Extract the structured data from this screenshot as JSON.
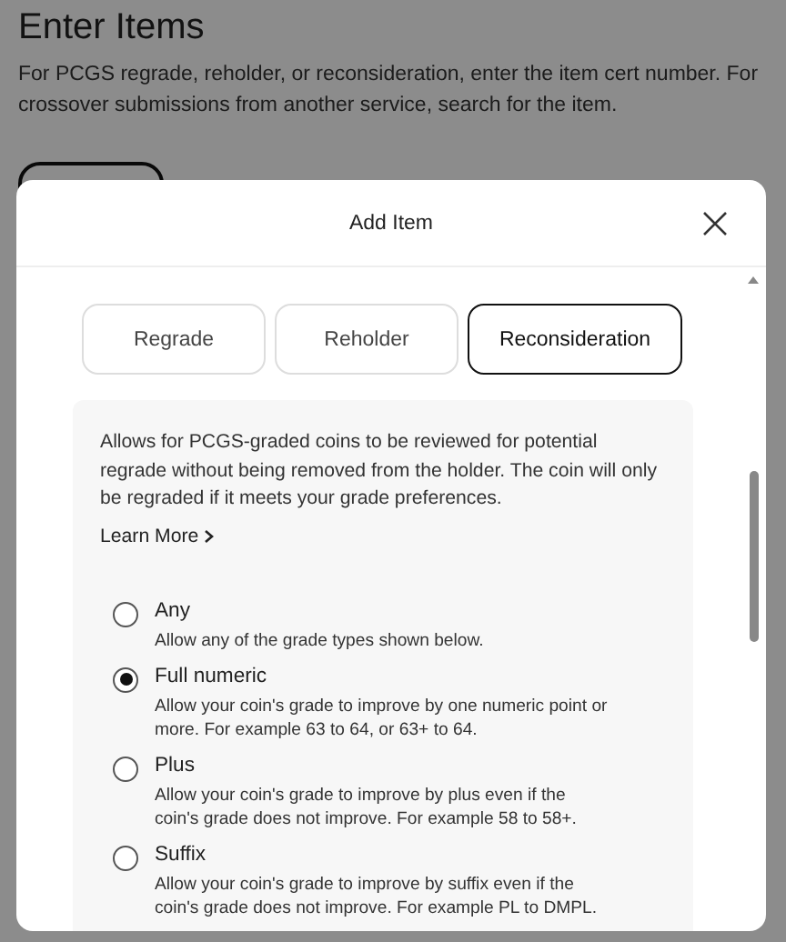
{
  "page": {
    "title": "Enter Items",
    "description": "For PCGS regrade, reholder, or reconsideration, enter the item cert number. For crossover submissions from another service, search for the item."
  },
  "modal": {
    "title": "Add Item",
    "tabs": [
      {
        "label": "Regrade",
        "selected": false
      },
      {
        "label": "Reholder",
        "selected": false
      },
      {
        "label": "Reconsideration",
        "selected": true
      }
    ],
    "info": "Allows for PCGS-graded coins to be reviewed for potential regrade without being removed from the holder. The coin will only be regraded if it meets your grade preferences.",
    "learn_more": "Learn More",
    "options": [
      {
        "label": "Any",
        "description": "Allow any of the grade types shown below.",
        "selected": false
      },
      {
        "label": "Full numeric",
        "description": "Allow your coin's grade to improve by one numeric point or more. For example 63 to 64, or 63+ to 64.",
        "selected": true
      },
      {
        "label": "Plus",
        "description": "Allow your coin's grade to improve by plus even if the coin's grade does not improve. For example 58 to 58+.",
        "selected": false
      },
      {
        "label": "Suffix",
        "description": "Allow your coin's grade to improve by suffix even if the coin's grade does not improve. For example PL to DMPL.",
        "selected": false
      }
    ]
  }
}
